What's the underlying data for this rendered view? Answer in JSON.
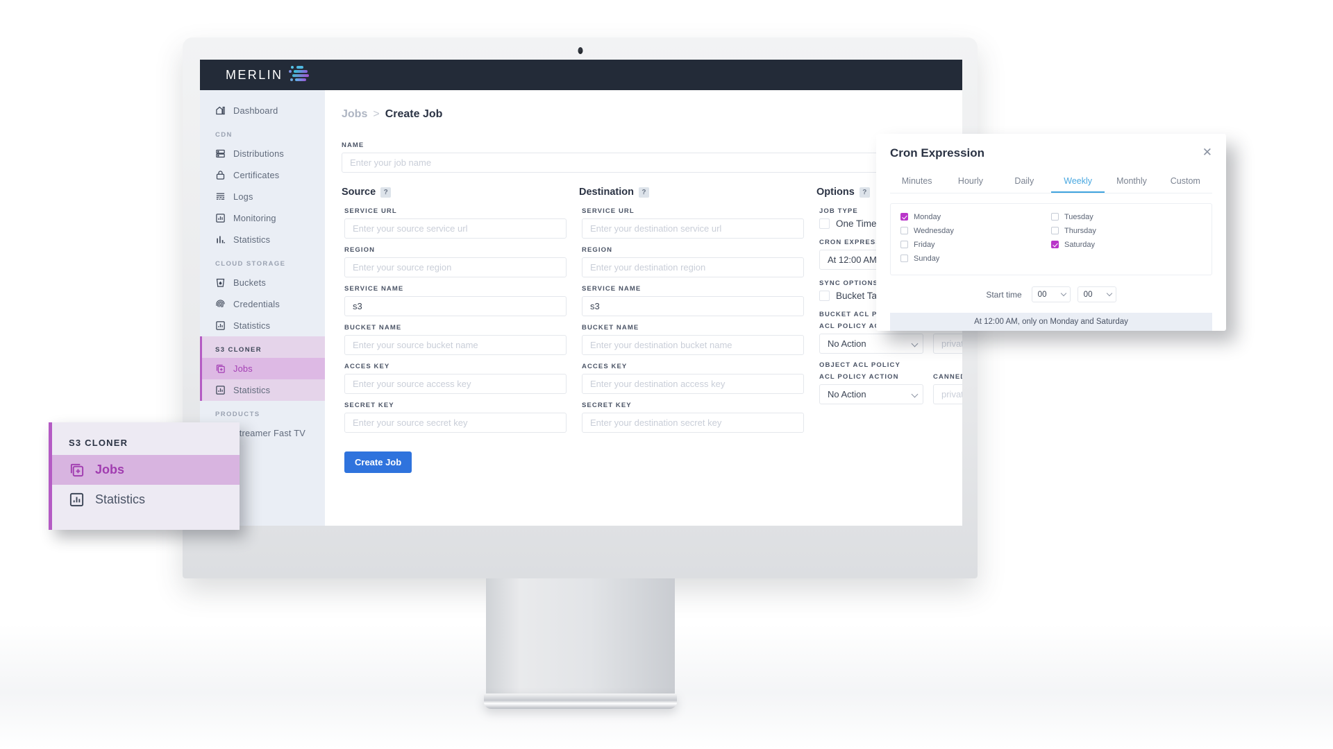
{
  "brand": {
    "name": "MERLIN",
    "mark_colors": [
      "#35c8d8",
      "#8f5ddb",
      "#5bb7e8",
      "#a74fd3"
    ]
  },
  "sidebar": {
    "top_items": [
      {
        "label": "Dashboard",
        "icon": "dashboard-icon"
      }
    ],
    "groups": [
      {
        "title": "CDN",
        "items": [
          {
            "label": "Distributions",
            "icon": "server-icon"
          },
          {
            "label": "Certificates",
            "icon": "lock-icon"
          },
          {
            "label": "Logs",
            "icon": "logs-icon"
          },
          {
            "label": "Monitoring",
            "icon": "monitor-chart-icon"
          },
          {
            "label": "Statistics",
            "icon": "bar-chart-icon"
          }
        ]
      },
      {
        "title": "CLOUD STORAGE",
        "items": [
          {
            "label": "Buckets",
            "icon": "bucket-icon"
          },
          {
            "label": "Credentials",
            "icon": "fingerprint-icon"
          },
          {
            "label": "Statistics",
            "icon": "chart-box-icon"
          }
        ]
      },
      {
        "title": "S3 CLONER",
        "highlighted": true,
        "items": [
          {
            "label": "Jobs",
            "icon": "jobs-icon",
            "active": true
          },
          {
            "label": "Statistics",
            "icon": "chart-box-icon",
            "active": false
          }
        ]
      },
      {
        "title": "PRODUCTS",
        "items": [
          {
            "label": "Streamer Fast TV",
            "icon": "tv-icon"
          }
        ]
      }
    ]
  },
  "breadcrumb": {
    "parent": "Jobs",
    "separator": ">",
    "current": "Create Job"
  },
  "name_field": {
    "label": "NAME",
    "placeholder": "Enter your job name",
    "value": ""
  },
  "source": {
    "title": "Source",
    "help": "?",
    "fields": [
      {
        "label": "SERVICE URL",
        "placeholder": "Enter your source service url",
        "value": ""
      },
      {
        "label": "REGION",
        "placeholder": "Enter your source region",
        "value": ""
      },
      {
        "label": "SERVICE NAME",
        "placeholder": "",
        "value": "s3"
      },
      {
        "label": "BUCKET NAME",
        "placeholder": "Enter your source bucket name",
        "value": ""
      },
      {
        "label": "ACCES KEY",
        "placeholder": "Enter your source access key",
        "value": ""
      },
      {
        "label": "SECRET KEY",
        "placeholder": "Enter your source secret key",
        "value": ""
      }
    ]
  },
  "destination": {
    "title": "Destination",
    "help": "?",
    "fields": [
      {
        "label": "SERVICE URL",
        "placeholder": "Enter your destination service url",
        "value": ""
      },
      {
        "label": "REGION",
        "placeholder": "Enter your destination region",
        "value": ""
      },
      {
        "label": "SERVICE NAME",
        "placeholder": "",
        "value": "s3"
      },
      {
        "label": "BUCKET NAME",
        "placeholder": "Enter your destination bucket name",
        "value": ""
      },
      {
        "label": "ACCES KEY",
        "placeholder": "Enter your destination access key",
        "value": ""
      },
      {
        "label": "SECRET KEY",
        "placeholder": "Enter your destination secret key",
        "value": ""
      }
    ]
  },
  "options": {
    "title": "Options",
    "help": "?",
    "job_type_label": "JOB TYPE",
    "job_type_option": "One Time",
    "job_type_checked": false,
    "cron_label": "CRON EXPRESSION",
    "cron_value": "At 12:00 AM",
    "sync_label": "SYNC OPTIONS",
    "sync_option": "Bucket Tagging",
    "sync_checked": false,
    "bucket_acl_title": "BUCKET ACL POLICY",
    "object_acl_title": "OBJECT ACL POLICY",
    "acl_action_label": "ACL POLICY ACTION",
    "canned_label": "CANNED ACL",
    "bucket_acl_action": "No Action",
    "bucket_canned": "private",
    "object_acl_action": "No Action",
    "object_canned": "private"
  },
  "create_button": "Create Job",
  "cron_modal": {
    "title": "Cron Expression",
    "close": "✕",
    "tabs": [
      {
        "label": "Minutes",
        "active": false
      },
      {
        "label": "Hourly",
        "active": false
      },
      {
        "label": "Daily",
        "active": false
      },
      {
        "label": "Weekly",
        "active": true
      },
      {
        "label": "Monthly",
        "active": false
      },
      {
        "label": "Custom",
        "active": false
      }
    ],
    "days_left": [
      {
        "label": "Monday",
        "checked": true
      },
      {
        "label": "Wednesday",
        "checked": false
      },
      {
        "label": "Friday",
        "checked": false
      },
      {
        "label": "Sunday",
        "checked": false
      }
    ],
    "days_right": [
      {
        "label": "Tuesday",
        "checked": false
      },
      {
        "label": "Thursday",
        "checked": false
      },
      {
        "label": "Saturday",
        "checked": true
      }
    ],
    "start_time_label": "Start time",
    "hour": "00",
    "minute": "00",
    "summary": "At 12:00 AM, only on Monday and Saturday",
    "accent_color": "#b935c9",
    "tab_active_color": "#3fa3de"
  },
  "callout": {
    "title": "S3 CLONER",
    "items": [
      {
        "label": "Jobs",
        "icon": "jobs-icon",
        "active": true
      },
      {
        "label": "Statistics",
        "icon": "chart-box-icon",
        "active": false
      }
    ]
  }
}
